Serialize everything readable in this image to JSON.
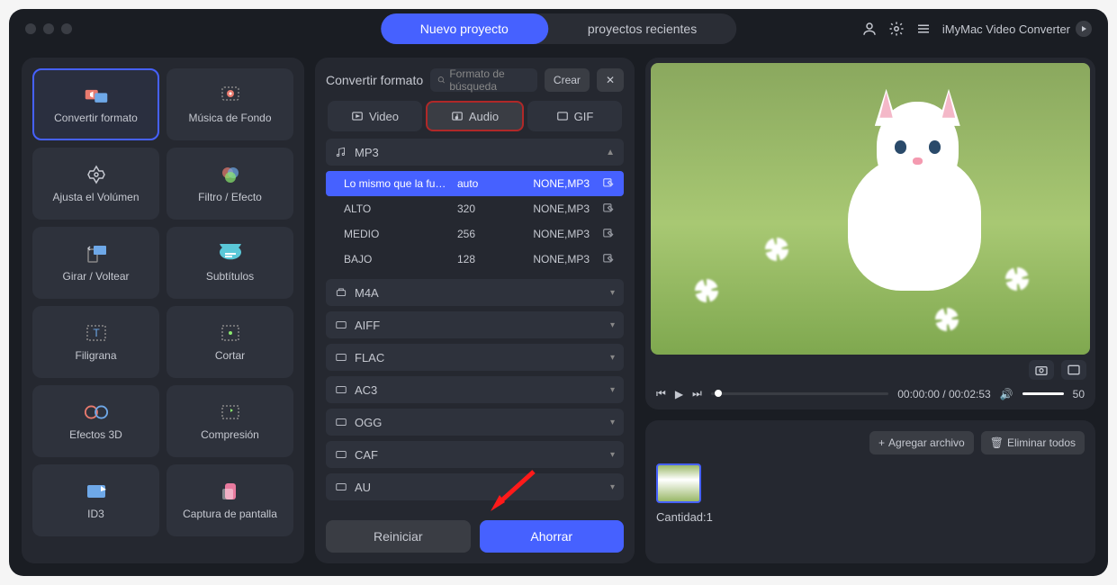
{
  "header": {
    "tab_new": "Nuevo proyecto",
    "tab_recent": "proyectos recientes",
    "brand": "iMyMac Video Converter"
  },
  "sidebar": {
    "items": [
      {
        "label": "Convertir formato"
      },
      {
        "label": "Música de Fondo"
      },
      {
        "label": "Ajusta el Volúmen"
      },
      {
        "label": "Filtro / Efecto"
      },
      {
        "label": "Girar / Voltear"
      },
      {
        "label": "Subtítulos"
      },
      {
        "label": "Filigrana"
      },
      {
        "label": "Cortar"
      },
      {
        "label": "Efectos 3D"
      },
      {
        "label": "Compresión"
      },
      {
        "label": "ID3"
      },
      {
        "label": "Captura de pantalla"
      }
    ]
  },
  "center": {
    "title": "Convertir formato",
    "search_placeholder": "Formato de búsqueda",
    "create": "Crear",
    "tab_video": "Video",
    "tab_audio": "Audio",
    "tab_gif": "GIF",
    "formats": [
      "MP3",
      "M4A",
      "AIFF",
      "FLAC",
      "AC3",
      "OGG",
      "CAF",
      "AU"
    ],
    "presets": [
      {
        "name": "Lo mismo que la fu…",
        "rate": "auto",
        "codec": "NONE,MP3"
      },
      {
        "name": "ALTO",
        "rate": "320",
        "codec": "NONE,MP3"
      },
      {
        "name": "MEDIO",
        "rate": "256",
        "codec": "NONE,MP3"
      },
      {
        "name": "BAJO",
        "rate": "128",
        "codec": "NONE,MP3"
      }
    ],
    "reset": "Reiniciar",
    "save": "Ahorrar"
  },
  "player": {
    "time": "00:00:00 / 00:02:53",
    "volume": "50"
  },
  "queue": {
    "add": "Agregar archivo",
    "remove": "Eliminar todos",
    "qty": "Cantidad:1"
  }
}
